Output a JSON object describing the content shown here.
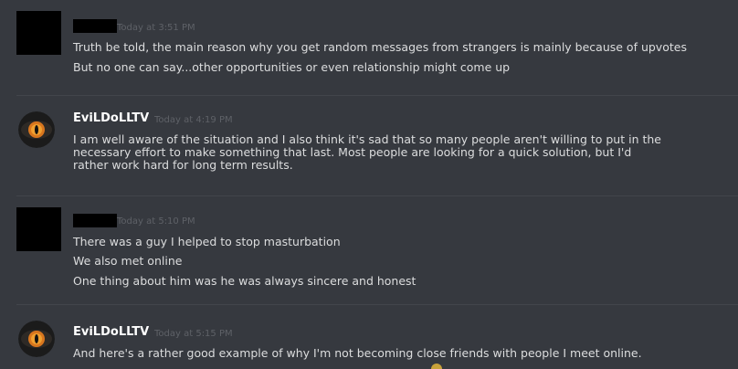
{
  "messages": [
    {
      "author": "",
      "author_redacted": true,
      "timestamp": "Today at 3:51 PM",
      "lines": [
        "Truth be told, the main reason why you get random messages from strangers is mainly because of upvotes",
        "But no one can say...other opportunities or even relationship might come up"
      ]
    },
    {
      "author": "EviLDoLLTV",
      "author_redacted": false,
      "timestamp": "Today at 4:19 PM",
      "lines": [
        "I am well aware of the situation and I also think it's sad that so many people aren't willing to put in the necessary effort to make something that last. Most people are looking for a quick solution, but I'd rather work hard for long term results."
      ]
    },
    {
      "author": "",
      "author_redacted": true,
      "timestamp": "Today at 5:10 PM",
      "lines": [
        "There was a guy I helped to stop masturbation",
        "We also met online",
        "One thing about him was he was always sincere and honest"
      ]
    },
    {
      "author": "EviLDoLLTV",
      "author_redacted": false,
      "timestamp": "Today at 5:15 PM",
      "lines": [
        "And here's a rather good example of why I'm not becoming close friends with people I meet online."
      ]
    }
  ],
  "colors": {
    "background": "#36393f",
    "text": "#dcddde",
    "username": "#ffffff",
    "timestamp": "#5e6167",
    "divider": "#42454b",
    "redaction": "#000000"
  },
  "icons": {
    "evildoll_avatar": "orange-eye-icon"
  }
}
